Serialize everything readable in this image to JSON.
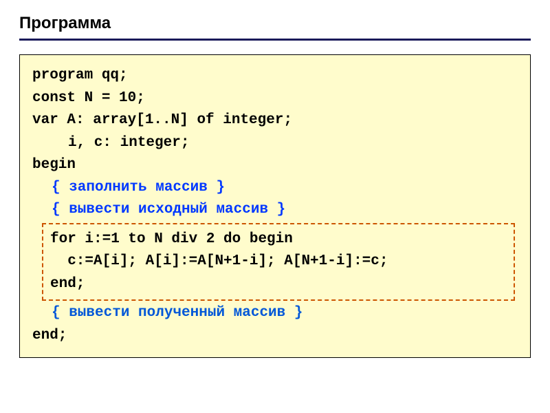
{
  "title": "Программа",
  "code": {
    "line1": "program qq;",
    "line2": "const N = 10;",
    "line3": "var A: array[1..N] of integer;",
    "line4": "i, c: integer;",
    "line5": "begin",
    "comment1": "{ заполнить массив }",
    "comment2": "{ вывести исходный массив }",
    "inner1": "for i:=1 to N div 2 do begin",
    "inner2": "  c:=A[i]; A[i]:=A[N+1-i]; A[N+1-i]:=c;",
    "inner3": "end;",
    "comment3": "{ вывести полученный массив }",
    "line_end": "end;"
  }
}
